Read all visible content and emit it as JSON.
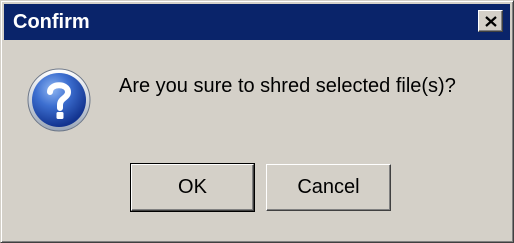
{
  "window": {
    "title": "Confirm",
    "title_bar_color": "#0a246a",
    "background_color": "#d4d0c8"
  },
  "titlebar": {
    "close_icon": "close-icon"
  },
  "dialog": {
    "icon": "question-icon",
    "message": "Are you sure to shred selected file(s)?"
  },
  "buttons": {
    "ok_label": "OK",
    "cancel_label": "Cancel"
  }
}
